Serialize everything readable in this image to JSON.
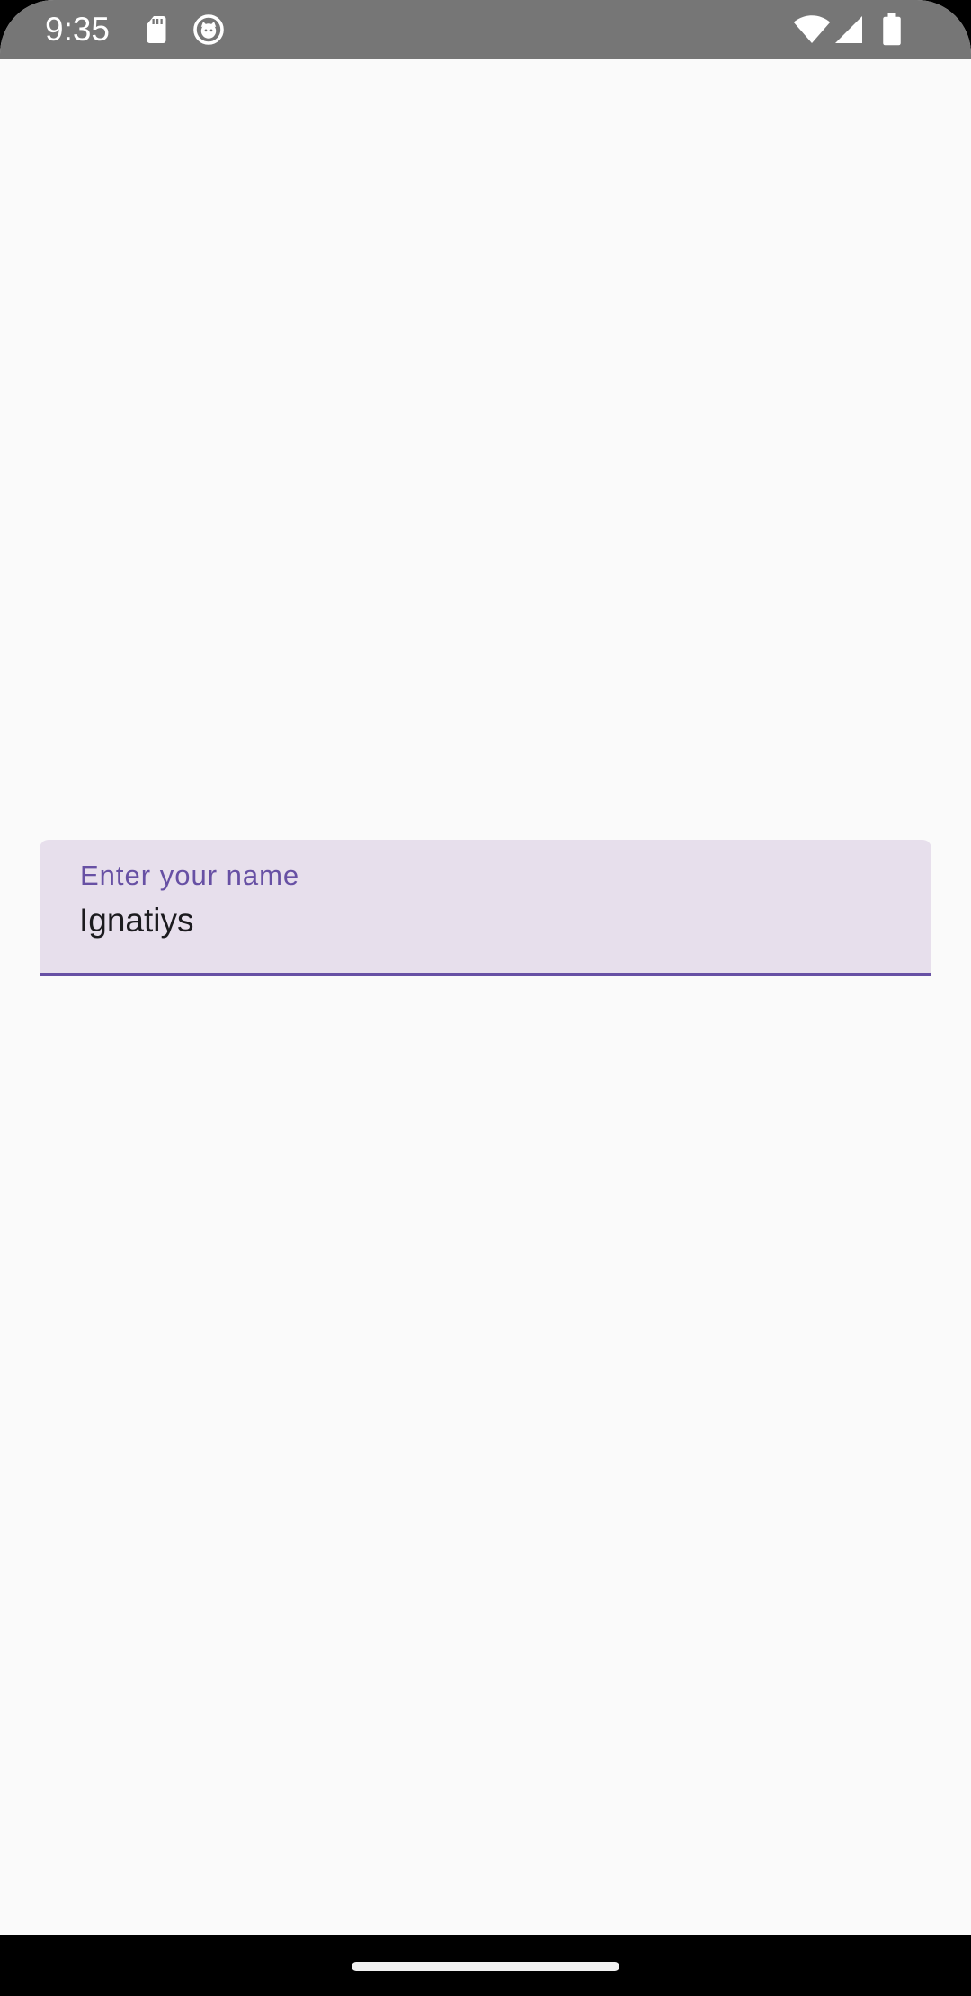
{
  "status_bar": {
    "time": "9:35",
    "icons": [
      "sd-card-icon",
      "app-notification-icon",
      "wifi-icon",
      "cell-signal-icon",
      "battery-icon"
    ],
    "background_color": "#767676"
  },
  "name_field": {
    "label": "Enter your name",
    "value": "Ignatiys",
    "accent_color": "#6750a4",
    "fill_color": "#e7dfec"
  },
  "navigation_bar": {
    "handle": "home-gesture-handle"
  }
}
